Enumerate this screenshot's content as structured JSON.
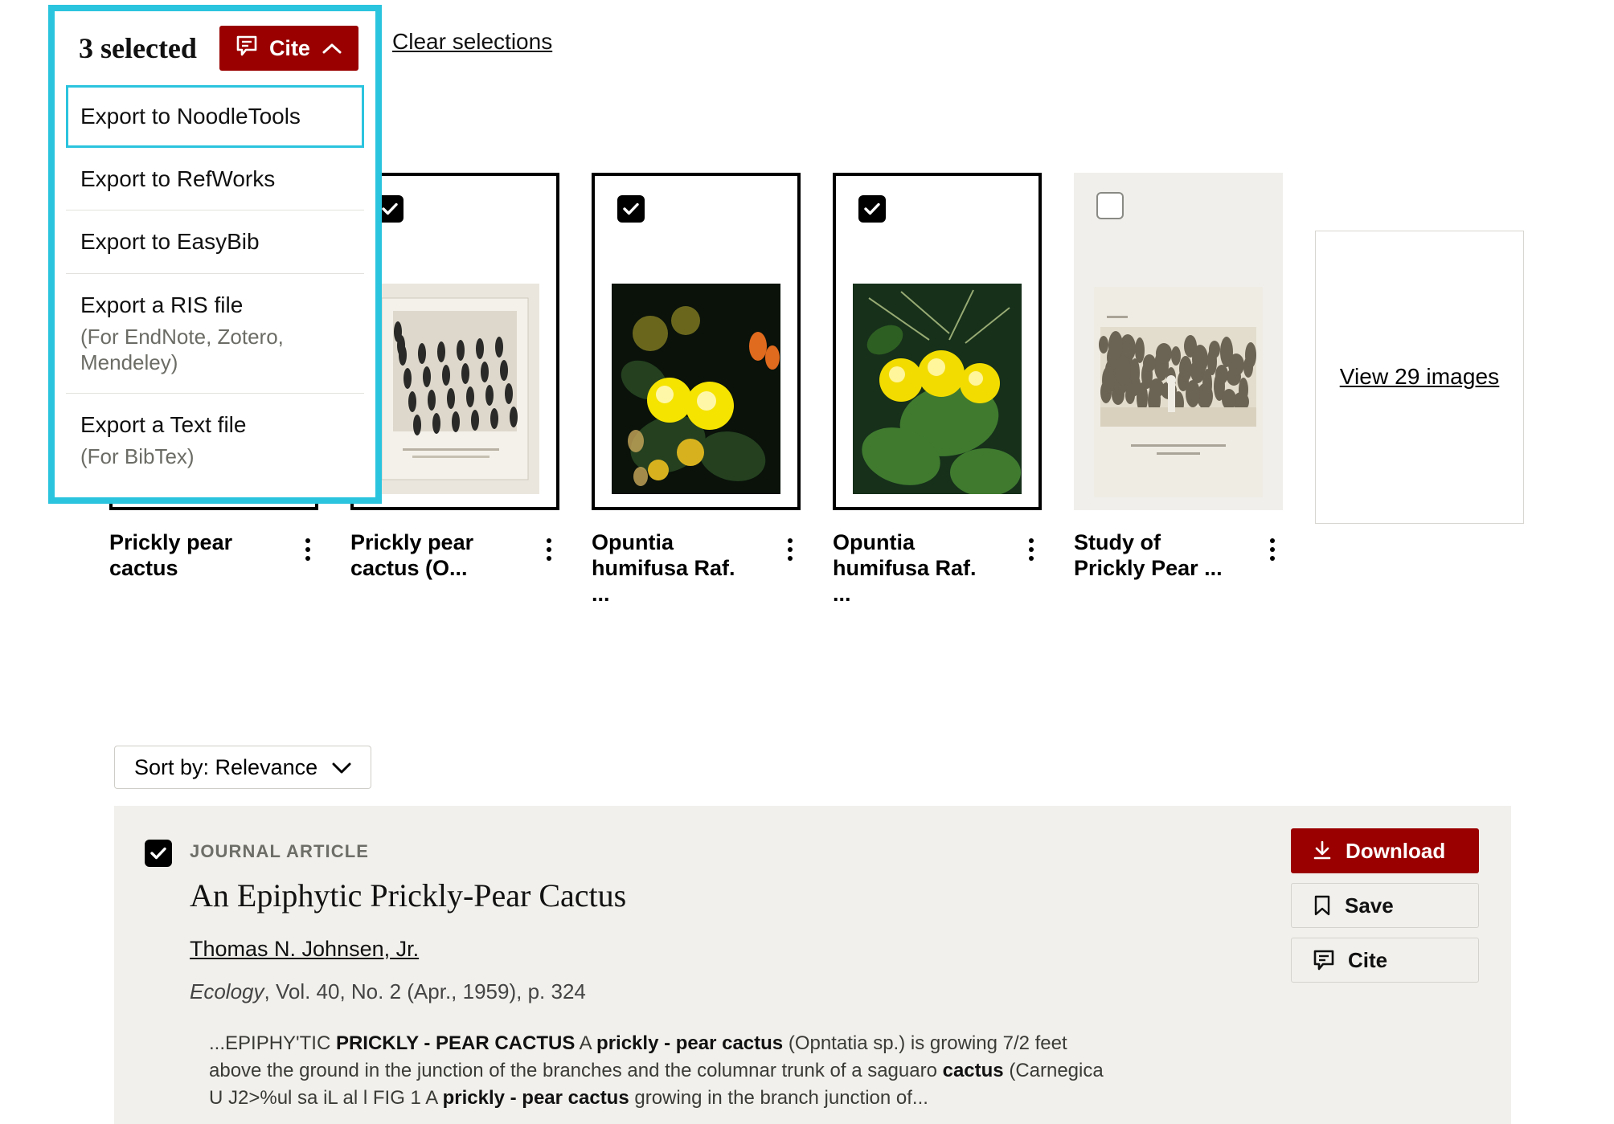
{
  "cite_panel": {
    "selected_label": "3 selected",
    "cite_button_label": "Cite",
    "cite_icon": "cite-speech-bubble-icon",
    "chevron_icon": "chevron-up-icon",
    "menu_items": [
      {
        "label": "Export to NoodleTools",
        "sub": "",
        "focused": true
      },
      {
        "label": "Export to RefWorks",
        "sub": "",
        "focused": false
      },
      {
        "label": "Export to EasyBib",
        "sub": "",
        "focused": false
      },
      {
        "label": "Export a RIS file",
        "sub": "(For EndNote, Zotero, Mendeley)",
        "focused": false
      },
      {
        "label": "Export a Text file",
        "sub": "(For BibTex)",
        "focused": false
      }
    ]
  },
  "clear_selections_label": "Clear selections",
  "image_strip": {
    "cards": [
      {
        "title": "Prickly pear cactus",
        "checked": true,
        "style": "selected",
        "kebab": "more-options-icon"
      },
      {
        "title": "Prickly pear cactus (O...",
        "checked": true,
        "style": "selected",
        "kebab": "more-options-icon"
      },
      {
        "title": "Opuntia humifusa Raf. ...",
        "checked": true,
        "style": "selected",
        "kebab": "more-options-icon"
      },
      {
        "title": "Opuntia humifusa Raf. ...",
        "checked": true,
        "style": "selected",
        "kebab": "more-options-icon"
      },
      {
        "title": "Study of Prickly Pear ...",
        "checked": false,
        "style": "plain",
        "kebab": "more-options-icon"
      }
    ],
    "more_card_label": "View 29 images"
  },
  "sort": {
    "label": "Sort by: Relevance",
    "chevron_icon": "chevron-down-icon"
  },
  "result": {
    "checked": true,
    "kind": "JOURNAL ARTICLE",
    "title": "An Epiphytic Prickly-Pear Cactus",
    "author": "Thomas N. Johnsen, Jr.",
    "journal": "Ecology",
    "citation_rest": ", Vol. 40, No. 2 (Apr., 1959), p. 324",
    "snippet_parts": [
      {
        "t": "...EPIPHY'TIC ",
        "b": false
      },
      {
        "t": "PRICKLY - PEAR CACTUS",
        "b": true
      },
      {
        "t": " A ",
        "b": false
      },
      {
        "t": "prickly - pear cactus",
        "b": true
      },
      {
        "t": " (Opntatia sp.) is growing 7/2 feet above the ground in the junction of the branches and the columnar trunk of a saguaro ",
        "b": false
      },
      {
        "t": "cactus",
        "b": true
      },
      {
        "t": " (Carnegica U J2>%ul sa iL al l FIG 1 A ",
        "b": false
      },
      {
        "t": "prickly - pear cactus",
        "b": true
      },
      {
        "t": " growing in the branch junction of...",
        "b": false
      }
    ],
    "actions": [
      {
        "label": "Download",
        "icon": "download-icon",
        "style": "primary"
      },
      {
        "label": "Save",
        "icon": "bookmark-icon",
        "style": "ghost"
      },
      {
        "label": "Cite",
        "icon": "cite-speech-bubble-icon",
        "style": "ghost"
      }
    ]
  },
  "colors": {
    "brand_red": "#9A0000",
    "highlight_cyan": "#2BC4DE",
    "card_bg": "#F1F0EC"
  }
}
